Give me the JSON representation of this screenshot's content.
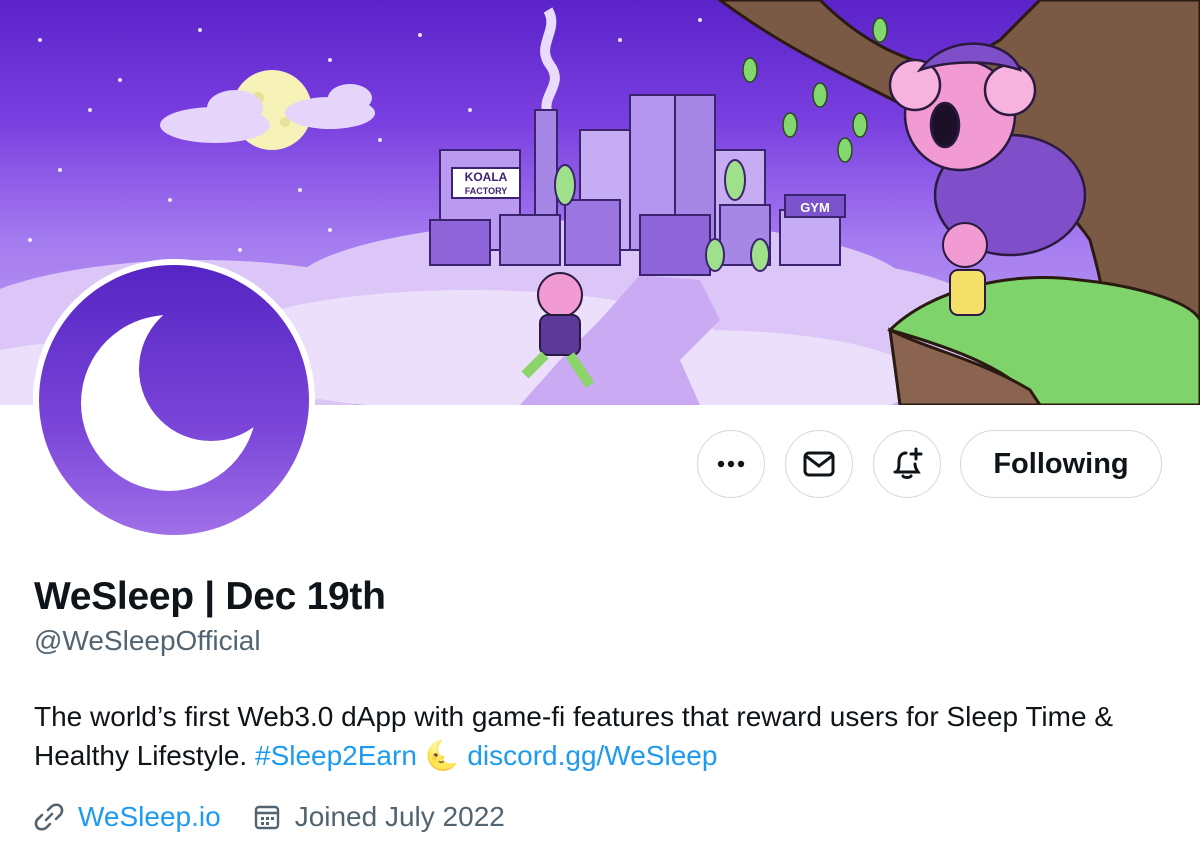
{
  "profile": {
    "display_name": "WeSleep | Dec 19th",
    "handle": "@WeSleepOfficial",
    "bio": {
      "text": "The world’s first Web3.0 dApp with game-fi features that reward users for Sleep Time & Healthy Lifestyle.",
      "hashtag": "#Sleep2Earn",
      "emoji": "🌜",
      "discord": "discord.gg/WeSleep"
    },
    "website": "WeSleep.io",
    "joined": "Joined July 2022"
  },
  "actions": {
    "more_icon": "ellipsis-icon",
    "message_icon": "envelope-icon",
    "notify_icon": "bell-plus-icon",
    "follow_label": "Following"
  },
  "banner": {
    "sign_factory_1": "KOALA",
    "sign_factory_2": "FACTORY",
    "sign_gym": "GYM"
  },
  "colors": {
    "link": "#1d9bf0",
    "secondary_text": "#536471",
    "primary_text": "#0f1419",
    "border": "#cfd9de",
    "avatar_purple": "#6a35d0"
  }
}
